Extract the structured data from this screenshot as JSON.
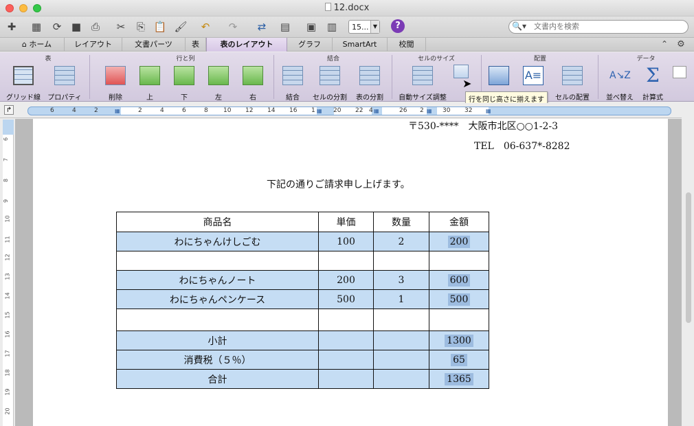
{
  "window": {
    "title": "12.docx"
  },
  "toolbar": {
    "zoom_value": "15...",
    "search_placeholder": "文書内を検索"
  },
  "tabs": [
    "ホーム",
    "レイアウト",
    "文書パーツ",
    "表",
    "表のレイアウト",
    "グラフ",
    "SmartArt",
    "校閲"
  ],
  "active_tab": "表のレイアウト",
  "ribbon": {
    "groups": {
      "table": "表",
      "rows_cols": "行と列",
      "merge": "結合",
      "cell_size": "セルのサイズ",
      "alignment": "配置",
      "data": "データ"
    },
    "buttons": {
      "gridlines": "グリッド線",
      "properties": "プロパティ",
      "delete": "削除",
      "above": "上",
      "below": "下",
      "left": "左",
      "right": "右",
      "merge": "結合",
      "split_cells": "セルの分割",
      "split_table": "表の分割",
      "autofit": "自動サイズ調整",
      "cell_align": "セルの配置",
      "sort": "並べ替え",
      "formula": "計算式"
    },
    "tooltip": "行を同じ高さに揃えます"
  },
  "ruler": {
    "h_numbers": [
      "6",
      "4",
      "2",
      "2",
      "4",
      "6",
      "8",
      "10",
      "12",
      "14",
      "16",
      "1",
      "20",
      "22",
      "4",
      "26",
      "2",
      "30",
      "32"
    ],
    "v_numbers": [
      "6",
      "7",
      "8",
      "9",
      "10",
      "11",
      "12",
      "13",
      "14",
      "15",
      "16",
      "17",
      "18",
      "19",
      "20"
    ]
  },
  "document": {
    "address_line1": "〒530-****　大阪市北区○○1-2-3",
    "address_line2": "TEL　06-637*-8282",
    "intro": "下記の通りご請求申し上げます。",
    "table": {
      "headers": [
        "商品名",
        "単価",
        "数量",
        "金額"
      ],
      "rows": [
        {
          "name": "わにちゃんけしごむ",
          "price": "100",
          "qty": "2",
          "amount": "200"
        },
        {
          "name": "",
          "price": "",
          "qty": "",
          "amount": ""
        },
        {
          "name": "わにちゃんノート",
          "price": "200",
          "qty": "3",
          "amount": "600"
        },
        {
          "name": "わにちゃんペンケース",
          "price": "500",
          "qty": "1",
          "amount": "500"
        },
        {
          "name": "",
          "price": "",
          "qty": "",
          "amount": ""
        },
        {
          "name": "小計",
          "price": "",
          "qty": "",
          "amount": "1300"
        },
        {
          "name": "消費税（５％）",
          "price": "",
          "qty": "",
          "amount": "65"
        },
        {
          "name": "合計",
          "price": "",
          "qty": "",
          "amount": "1365"
        }
      ]
    }
  }
}
